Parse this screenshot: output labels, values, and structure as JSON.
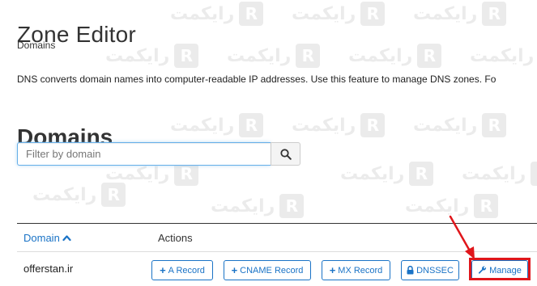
{
  "header": {
    "title": "Zone Editor",
    "breadcrumb": "Domains"
  },
  "description": "DNS converts domain names into computer-readable IP addresses. Use this feature to manage DNS zones. Fo",
  "section": {
    "title": "Domains"
  },
  "search": {
    "placeholder": "Filter by domain",
    "value": "",
    "button_icon": "search-icon"
  },
  "table": {
    "columns": [
      {
        "label": "Domain",
        "sort": "ascending",
        "sort_icon": "chevron-up-icon"
      },
      {
        "label": "Actions"
      }
    ],
    "rows": [
      {
        "domain": "offerstan.ir",
        "actions": [
          {
            "label": "A Record",
            "icon": "plus-icon"
          },
          {
            "label": "CNAME Record",
            "icon": "plus-icon"
          },
          {
            "label": "MX Record",
            "icon": "plus-icon"
          },
          {
            "label": "DNSSEC",
            "icon": "lock-icon"
          },
          {
            "label": "Manage",
            "icon": "wrench-icon"
          }
        ]
      }
    ]
  },
  "annotation": {
    "highlight_color": "#e0161b",
    "target": "Manage"
  },
  "colors": {
    "link": "#1a73c6",
    "text": "#333333",
    "highlight": "#e0161b"
  }
}
